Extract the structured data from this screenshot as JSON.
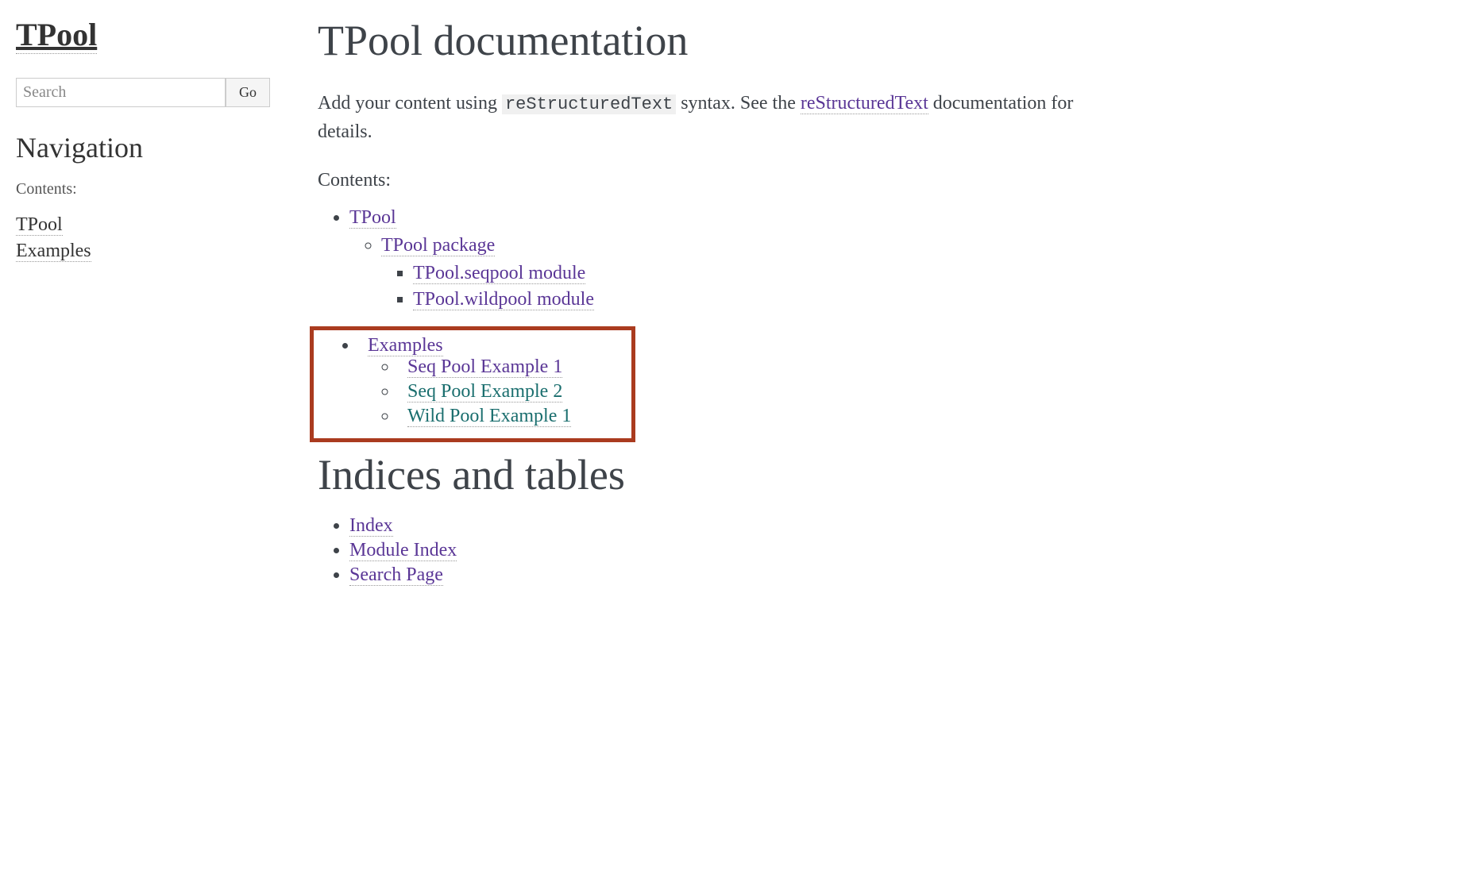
{
  "sidebar": {
    "site_title": "TPool",
    "search_placeholder": "Search",
    "go_label": "Go",
    "nav_heading": "Navigation",
    "contents_label": "Contents:",
    "items": [
      {
        "label": "TPool"
      },
      {
        "label": "Examples"
      }
    ]
  },
  "main": {
    "title": "TPool documentation",
    "intro_prefix": "Add your content using ",
    "intro_code": "reStructuredText",
    "intro_mid": " syntax. See the ",
    "intro_link": "reStructuredText",
    "intro_suffix": " documen­tation for details.",
    "contents_label": "Contents:",
    "toc": {
      "item1": {
        "label": "TPool",
        "children": [
          {
            "label": "TPool package",
            "children": [
              {
                "label": "TPool.seqpool module"
              },
              {
                "label": "TPool.wildpool module"
              }
            ]
          }
        ]
      },
      "item2": {
        "label": "Examples",
        "children": [
          {
            "label": "Seq Pool Example 1",
            "color": "purple"
          },
          {
            "label": "Seq Pool Example 2",
            "color": "teal"
          },
          {
            "label": "Wild Pool Example 1",
            "color": "teal"
          }
        ]
      }
    },
    "indices_heading": "Indices and tables",
    "indices": [
      {
        "label": "Index"
      },
      {
        "label": "Module Index"
      },
      {
        "label": "Search Page"
      }
    ]
  }
}
